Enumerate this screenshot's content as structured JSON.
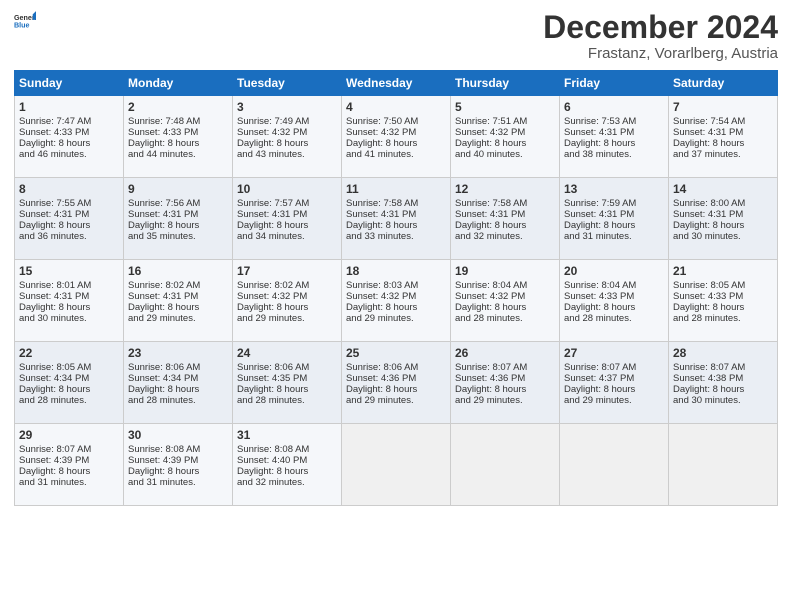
{
  "header": {
    "logo_general": "General",
    "logo_blue": "Blue",
    "month": "December 2024",
    "location": "Frastanz, Vorarlberg, Austria"
  },
  "days_header": [
    "Sunday",
    "Monday",
    "Tuesday",
    "Wednesday",
    "Thursday",
    "Friday",
    "Saturday"
  ],
  "weeks": [
    [
      {
        "day": "1",
        "lines": [
          "Sunrise: 7:47 AM",
          "Sunset: 4:33 PM",
          "Daylight: 8 hours",
          "and 46 minutes."
        ]
      },
      {
        "day": "2",
        "lines": [
          "Sunrise: 7:48 AM",
          "Sunset: 4:33 PM",
          "Daylight: 8 hours",
          "and 44 minutes."
        ]
      },
      {
        "day": "3",
        "lines": [
          "Sunrise: 7:49 AM",
          "Sunset: 4:32 PM",
          "Daylight: 8 hours",
          "and 43 minutes."
        ]
      },
      {
        "day": "4",
        "lines": [
          "Sunrise: 7:50 AM",
          "Sunset: 4:32 PM",
          "Daylight: 8 hours",
          "and 41 minutes."
        ]
      },
      {
        "day": "5",
        "lines": [
          "Sunrise: 7:51 AM",
          "Sunset: 4:32 PM",
          "Daylight: 8 hours",
          "and 40 minutes."
        ]
      },
      {
        "day": "6",
        "lines": [
          "Sunrise: 7:53 AM",
          "Sunset: 4:31 PM",
          "Daylight: 8 hours",
          "and 38 minutes."
        ]
      },
      {
        "day": "7",
        "lines": [
          "Sunrise: 7:54 AM",
          "Sunset: 4:31 PM",
          "Daylight: 8 hours",
          "and 37 minutes."
        ]
      }
    ],
    [
      {
        "day": "8",
        "lines": [
          "Sunrise: 7:55 AM",
          "Sunset: 4:31 PM",
          "Daylight: 8 hours",
          "and 36 minutes."
        ]
      },
      {
        "day": "9",
        "lines": [
          "Sunrise: 7:56 AM",
          "Sunset: 4:31 PM",
          "Daylight: 8 hours",
          "and 35 minutes."
        ]
      },
      {
        "day": "10",
        "lines": [
          "Sunrise: 7:57 AM",
          "Sunset: 4:31 PM",
          "Daylight: 8 hours",
          "and 34 minutes."
        ]
      },
      {
        "day": "11",
        "lines": [
          "Sunrise: 7:58 AM",
          "Sunset: 4:31 PM",
          "Daylight: 8 hours",
          "and 33 minutes."
        ]
      },
      {
        "day": "12",
        "lines": [
          "Sunrise: 7:58 AM",
          "Sunset: 4:31 PM",
          "Daylight: 8 hours",
          "and 32 minutes."
        ]
      },
      {
        "day": "13",
        "lines": [
          "Sunrise: 7:59 AM",
          "Sunset: 4:31 PM",
          "Daylight: 8 hours",
          "and 31 minutes."
        ]
      },
      {
        "day": "14",
        "lines": [
          "Sunrise: 8:00 AM",
          "Sunset: 4:31 PM",
          "Daylight: 8 hours",
          "and 30 minutes."
        ]
      }
    ],
    [
      {
        "day": "15",
        "lines": [
          "Sunrise: 8:01 AM",
          "Sunset: 4:31 PM",
          "Daylight: 8 hours",
          "and 30 minutes."
        ]
      },
      {
        "day": "16",
        "lines": [
          "Sunrise: 8:02 AM",
          "Sunset: 4:31 PM",
          "Daylight: 8 hours",
          "and 29 minutes."
        ]
      },
      {
        "day": "17",
        "lines": [
          "Sunrise: 8:02 AM",
          "Sunset: 4:32 PM",
          "Daylight: 8 hours",
          "and 29 minutes."
        ]
      },
      {
        "day": "18",
        "lines": [
          "Sunrise: 8:03 AM",
          "Sunset: 4:32 PM",
          "Daylight: 8 hours",
          "and 29 minutes."
        ]
      },
      {
        "day": "19",
        "lines": [
          "Sunrise: 8:04 AM",
          "Sunset: 4:32 PM",
          "Daylight: 8 hours",
          "and 28 minutes."
        ]
      },
      {
        "day": "20",
        "lines": [
          "Sunrise: 8:04 AM",
          "Sunset: 4:33 PM",
          "Daylight: 8 hours",
          "and 28 minutes."
        ]
      },
      {
        "day": "21",
        "lines": [
          "Sunrise: 8:05 AM",
          "Sunset: 4:33 PM",
          "Daylight: 8 hours",
          "and 28 minutes."
        ]
      }
    ],
    [
      {
        "day": "22",
        "lines": [
          "Sunrise: 8:05 AM",
          "Sunset: 4:34 PM",
          "Daylight: 8 hours",
          "and 28 minutes."
        ]
      },
      {
        "day": "23",
        "lines": [
          "Sunrise: 8:06 AM",
          "Sunset: 4:34 PM",
          "Daylight: 8 hours",
          "and 28 minutes."
        ]
      },
      {
        "day": "24",
        "lines": [
          "Sunrise: 8:06 AM",
          "Sunset: 4:35 PM",
          "Daylight: 8 hours",
          "and 28 minutes."
        ]
      },
      {
        "day": "25",
        "lines": [
          "Sunrise: 8:06 AM",
          "Sunset: 4:36 PM",
          "Daylight: 8 hours",
          "and 29 minutes."
        ]
      },
      {
        "day": "26",
        "lines": [
          "Sunrise: 8:07 AM",
          "Sunset: 4:36 PM",
          "Daylight: 8 hours",
          "and 29 minutes."
        ]
      },
      {
        "day": "27",
        "lines": [
          "Sunrise: 8:07 AM",
          "Sunset: 4:37 PM",
          "Daylight: 8 hours",
          "and 29 minutes."
        ]
      },
      {
        "day": "28",
        "lines": [
          "Sunrise: 8:07 AM",
          "Sunset: 4:38 PM",
          "Daylight: 8 hours",
          "and 30 minutes."
        ]
      }
    ],
    [
      {
        "day": "29",
        "lines": [
          "Sunrise: 8:07 AM",
          "Sunset: 4:39 PM",
          "Daylight: 8 hours",
          "and 31 minutes."
        ]
      },
      {
        "day": "30",
        "lines": [
          "Sunrise: 8:08 AM",
          "Sunset: 4:39 PM",
          "Daylight: 8 hours",
          "and 31 minutes."
        ]
      },
      {
        "day": "31",
        "lines": [
          "Sunrise: 8:08 AM",
          "Sunset: 4:40 PM",
          "Daylight: 8 hours",
          "and 32 minutes."
        ]
      },
      {
        "day": "",
        "lines": []
      },
      {
        "day": "",
        "lines": []
      },
      {
        "day": "",
        "lines": []
      },
      {
        "day": "",
        "lines": []
      }
    ]
  ]
}
